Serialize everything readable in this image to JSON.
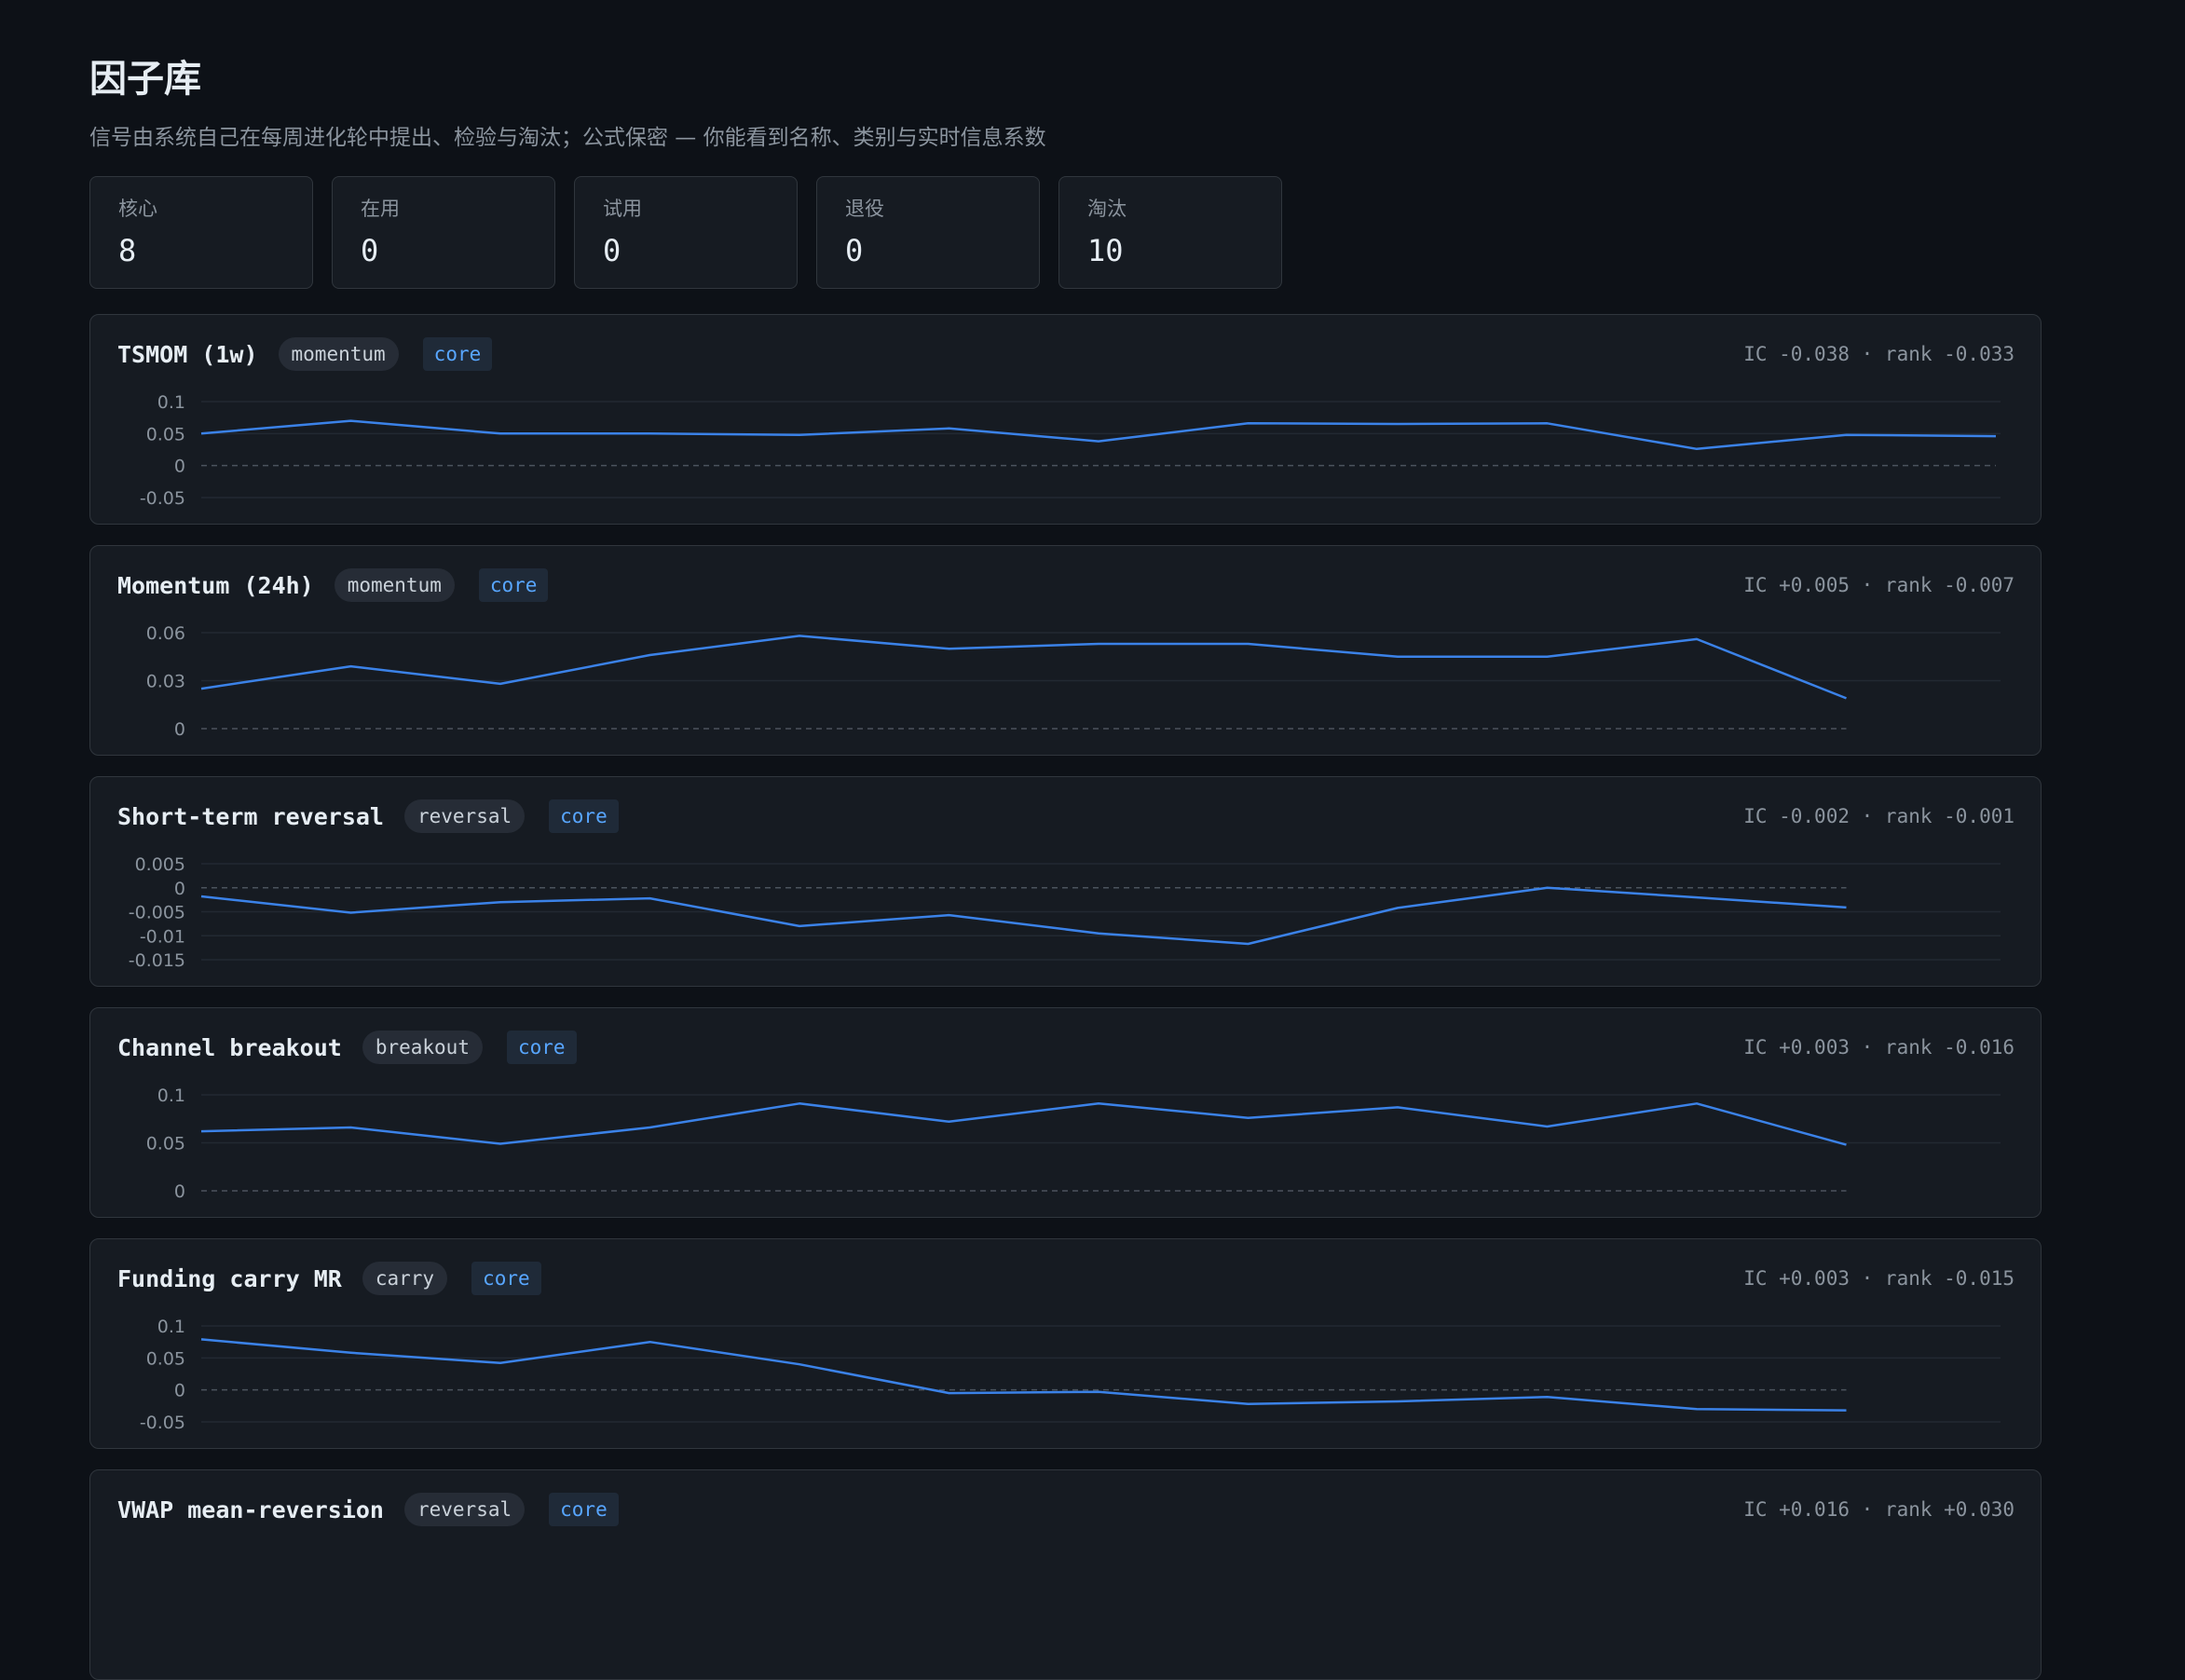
{
  "header": {
    "title": "因子库",
    "subtitle": "信号由系统自己在每周进化轮中提出、检验与淘汰；公式保密 — 你能看到名称、类别与实时信息系数"
  },
  "stats": [
    {
      "label": "核心",
      "value": "8"
    },
    {
      "label": "在用",
      "value": "0"
    },
    {
      "label": "试用",
      "value": "0"
    },
    {
      "label": "退役",
      "value": "0"
    },
    {
      "label": "淘汰",
      "value": "10"
    }
  ],
  "colors": {
    "line": "#3b82e8",
    "background": "#0d1117",
    "card": "#161b22",
    "status": "#58a6ff"
  },
  "factors": [
    {
      "name": "TSMOM (1w)",
      "category": "momentum",
      "status": "core",
      "ic": "IC -0.038 · rank -0.033"
    },
    {
      "name": "Momentum (24h)",
      "category": "momentum",
      "status": "core",
      "ic": "IC +0.005 · rank -0.007"
    },
    {
      "name": "Short-term reversal",
      "category": "reversal",
      "status": "core",
      "ic": "IC -0.002 · rank -0.001"
    },
    {
      "name": "Channel breakout",
      "category": "breakout",
      "status": "core",
      "ic": "IC +0.003 · rank -0.016"
    },
    {
      "name": "Funding carry MR",
      "category": "carry",
      "status": "core",
      "ic": "IC +0.003 · rank -0.015"
    },
    {
      "name": "VWAP mean-reversion",
      "category": "reversal",
      "status": "core",
      "ic": "IC +0.016 · rank +0.030"
    }
  ],
  "chart_data": [
    {
      "type": "line",
      "y_ticks": [
        "0.1",
        "0.05",
        "0",
        "-0.05"
      ],
      "ylim": [
        -0.05,
        0.1
      ],
      "values": [
        0.05,
        0.07,
        0.05,
        0.05,
        0.048,
        0.058,
        0.038,
        0.066,
        0.065,
        0.066,
        0.026,
        0.048,
        0.046
      ]
    },
    {
      "type": "line",
      "y_ticks": [
        "0.06",
        "0.03",
        "0"
      ],
      "ylim": [
        0,
        0.06
      ],
      "values": [
        0.025,
        0.039,
        0.028,
        0.046,
        0.058,
        0.05,
        0.053,
        0.053,
        0.045,
        0.045,
        0.056,
        0.019
      ]
    },
    {
      "type": "line",
      "y_ticks": [
        "0.005",
        "0",
        "-0.005",
        "-0.01",
        "-0.015"
      ],
      "ylim": [
        -0.015,
        0.005
      ],
      "values": [
        -0.0018,
        -0.0052,
        -0.003,
        -0.0022,
        -0.008,
        -0.0057,
        -0.0095,
        -0.0117,
        -0.0042,
        0,
        -0.002,
        -0.0041
      ]
    },
    {
      "type": "line",
      "y_ticks": [
        "0.1",
        "0.05",
        "0"
      ],
      "ylim": [
        0,
        0.1
      ],
      "values": [
        0.062,
        0.066,
        0.049,
        0.066,
        0.091,
        0.072,
        0.091,
        0.076,
        0.087,
        0.067,
        0.091,
        0.048
      ]
    },
    {
      "type": "line",
      "y_ticks": [
        "0.1",
        "0.05",
        "0",
        "-0.05"
      ],
      "ylim": [
        -0.05,
        0.1
      ],
      "values": [
        0.079,
        0.058,
        0.042,
        0.075,
        0.04,
        -0.005,
        -0.003,
        -0.022,
        -0.018,
        -0.011,
        -0.03,
        -0.032
      ]
    },
    {
      "type": "line",
      "y_ticks": [],
      "values": []
    }
  ]
}
